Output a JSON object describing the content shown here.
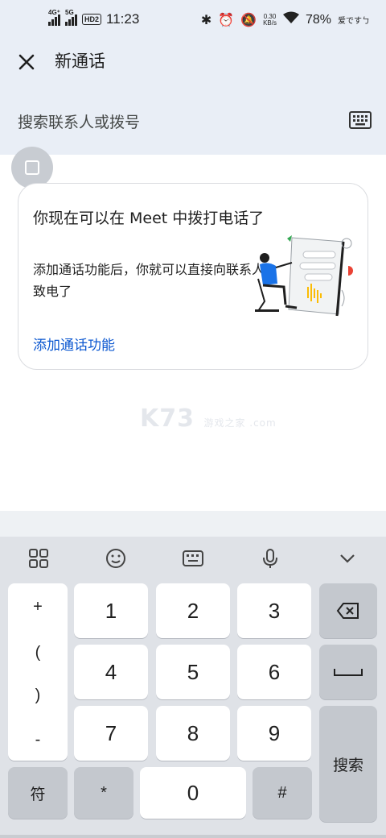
{
  "status_bar": {
    "network1": "4G⁺",
    "network2": "5G",
    "hd": "HD2",
    "time": "11:23",
    "speed_value": "0.30",
    "speed_unit": "KB/s",
    "battery": "78%",
    "carrier": "爱ですㄅ"
  },
  "header": {
    "title": "新通话",
    "search_placeholder": "搜索联系人或拨号"
  },
  "promo_card": {
    "title": "你现在可以在 Meet 中拨打电话了",
    "body": "添加通话功能后，你就可以直接向联系人致电了",
    "link": "添加通话功能"
  },
  "watermark": {
    "text": "K73",
    "sub": "游戏之家 .com"
  },
  "keyboard": {
    "toolbar_icons": [
      "grid-icon",
      "emoji-icon",
      "keyboard-icon",
      "mic-icon",
      "chevron-down-icon"
    ],
    "symbols": [
      "+",
      "(",
      ")",
      "-"
    ],
    "digits": [
      "1",
      "2",
      "3",
      "4",
      "5",
      "6",
      "7",
      "8",
      "9",
      "0"
    ],
    "fu": "符",
    "star": "*",
    "hash": "#",
    "search": "搜索"
  }
}
